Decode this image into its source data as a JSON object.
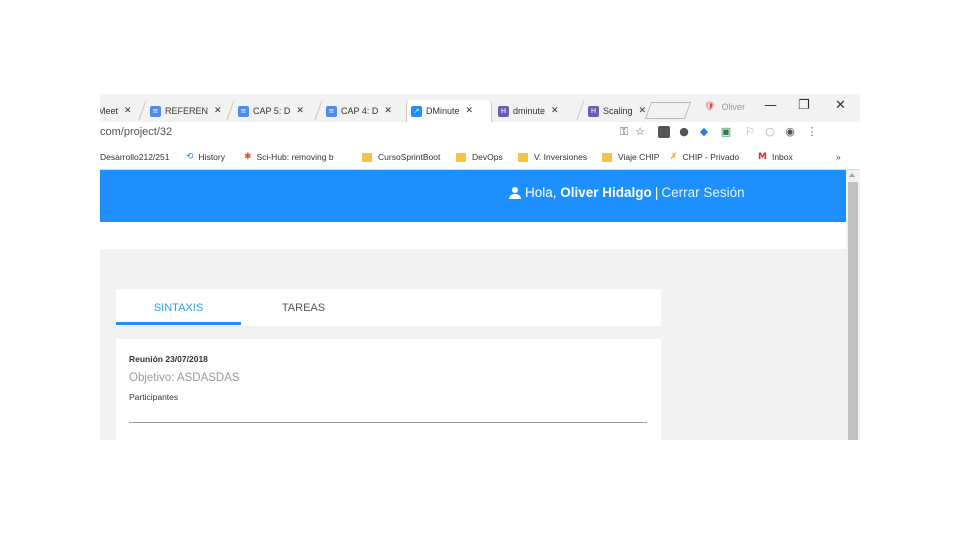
{
  "browser": {
    "tabs": [
      {
        "label": "Meet",
        "icon": "meet-icon",
        "icon_color": "#ffffff"
      },
      {
        "label": "REFEREN",
        "icon": "docs-icon",
        "icon_color": "#4a8cf7"
      },
      {
        "label": "CAP 5: D",
        "icon": "docs-icon",
        "icon_color": "#4a8cf7"
      },
      {
        "label": "CAP 4: D",
        "icon": "docs-icon",
        "icon_color": "#4a8cf7"
      },
      {
        "label": "DMinute",
        "icon": "dminute-icon",
        "icon_color": "#1e8ffe",
        "active": true
      },
      {
        "label": "dminute",
        "icon": "heroku-icon",
        "icon_color": "#6f5bb5"
      },
      {
        "label": "Scaling",
        "icon": "heroku-icon",
        "icon_color": "#6f5bb5"
      }
    ],
    "close_glyph": "✕",
    "profile_name": "Oliver",
    "window_controls": {
      "minimize": "—",
      "restore": "❐",
      "close": "✕"
    },
    "address": "com/project/32",
    "toolbar_icons": [
      "key-icon",
      "star-icon",
      "extension-icon",
      "extension-icon",
      "extension-icon",
      "extension-icon",
      "extension-icon",
      "extension-icon",
      "extension-icon",
      "menu-icon"
    ],
    "bookmarks": [
      {
        "label": "Desarrollo212/251",
        "type": "link"
      },
      {
        "label": "History",
        "type": "link",
        "icon": "history-icon"
      },
      {
        "label": "Sci-Hub: removing b",
        "type": "link",
        "icon": "scihub-icon"
      },
      {
        "label": "CursoSprintBoot",
        "type": "folder"
      },
      {
        "label": "DevOps",
        "type": "folder"
      },
      {
        "label": "V. Inversiones",
        "type": "folder"
      },
      {
        "label": "Viaje CHIP",
        "type": "folder"
      },
      {
        "label": "CHIP - Privado",
        "type": "link",
        "icon": "chip-icon"
      },
      {
        "label": "Inbox",
        "type": "link",
        "icon": "gmail-icon"
      }
    ],
    "bookmarks_more": "»"
  },
  "app": {
    "accent": "#1e8ffe",
    "greeting_prefix": "Hola,",
    "user_name": "Oliver Hidalgo",
    "separator": "|",
    "logout_label": "Cerrar Sesión",
    "tabs": [
      {
        "label": "SINTAXIS",
        "active": true
      },
      {
        "label": "TAREAS",
        "active": false
      }
    ],
    "meeting": {
      "title": "Reunión 23/07/2018",
      "objective": "Objetivo: ASDASDAS",
      "participants_label": "Participantes"
    }
  }
}
